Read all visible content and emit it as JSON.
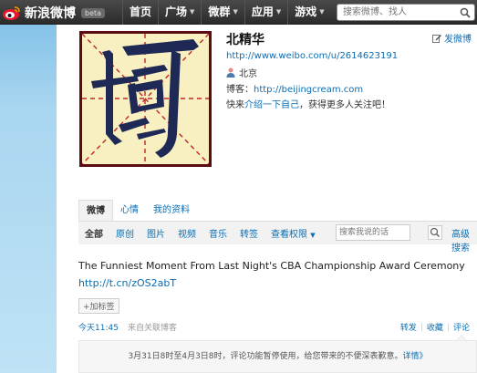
{
  "header": {
    "logo_text": "新浪微博",
    "beta_badge": "beta",
    "nav": [
      {
        "label": "首页",
        "has_caret": false
      },
      {
        "label": "广场",
        "has_caret": true
      },
      {
        "label": "微群",
        "has_caret": true
      },
      {
        "label": "应用",
        "has_caret": true
      },
      {
        "label": "游戏",
        "has_caret": true
      }
    ],
    "search_placeholder": "搜索微博、找人"
  },
  "profile": {
    "name": "北精华",
    "edit_label": "发微博",
    "url": "http://www.weibo.com/u/2614623191",
    "location": "北京",
    "blog_label": "博客：",
    "blog_url": "http://beijingcream.com",
    "intro_prefix": "快来",
    "intro_link": "介绍一下自己",
    "intro_suffix": "，获得更多人关注吧！"
  },
  "tabs": [
    {
      "label": "微博",
      "active": true
    },
    {
      "label": "心情",
      "active": false
    },
    {
      "label": "我的资料",
      "active": false
    }
  ],
  "filters": [
    {
      "label": "全部",
      "active": true
    },
    {
      "label": "原创",
      "active": false
    },
    {
      "label": "图片",
      "active": false
    },
    {
      "label": "视频",
      "active": false
    },
    {
      "label": "音乐",
      "active": false
    },
    {
      "label": "转签",
      "active": false
    },
    {
      "label": "查看权限",
      "active": false
    }
  ],
  "filter_search_placeholder": "搜索我说的话",
  "advanced_search": "高级搜索",
  "post": {
    "text": "The Funniest Moment From Last Night's CBA Championship Award Ceremony",
    "link": "http://t.cn/zOS2abT",
    "tag_button": "+加标签",
    "time": "今天11:45",
    "source": "来自关联博客",
    "actions": [
      "转发",
      "收藏",
      "评论"
    ],
    "notice_text": "3月31日8时至4月3日8时，评论功能暂停使用，给您带来的不便深表歉意。",
    "notice_link": "详情》"
  },
  "colors": {
    "topbar": "#2b2b2b",
    "link": "#0a6db3",
    "avatar_border": "#5a0e14",
    "avatar_bg": "#f8f0c0"
  }
}
